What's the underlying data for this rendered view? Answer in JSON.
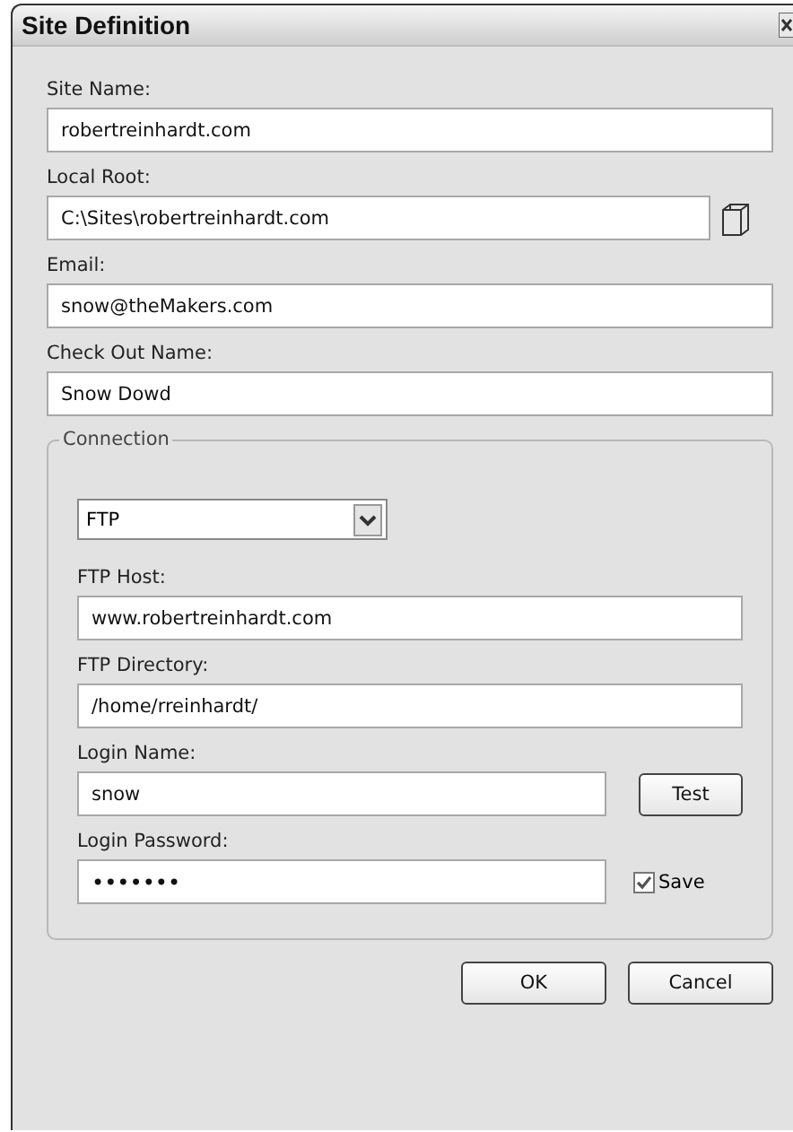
{
  "window": {
    "title": "Site Definition"
  },
  "fields": [
    {
      "label": "Site Name:",
      "value": "robertreinhardt.com",
      "kind": "text"
    },
    {
      "label": "Local Root:",
      "value": "C:\\Sites\\robertreinhardt.com",
      "kind": "browse"
    },
    {
      "label": "Email:",
      "value": "snow@theMakers.com",
      "kind": "text"
    },
    {
      "label": "Check Out Name:",
      "value": "Snow Dowd",
      "kind": "text"
    }
  ],
  "connection": {
    "legend": "Connection",
    "type": "FTP",
    "fields": [
      {
        "label": "FTP Host:",
        "value": "www.robertreinhardt.com",
        "kind": "text"
      },
      {
        "label": "FTP Directory:",
        "value": "/home/rreinhardt/",
        "kind": "text"
      },
      {
        "label": "Login Name:",
        "value": "snow",
        "kind": "test",
        "button": "Test"
      },
      {
        "label": "Login Password:",
        "value": "•••••••",
        "kind": "password",
        "checkbox": {
          "label": "Save",
          "checked": true
        }
      }
    ]
  },
  "buttons": [
    "OK",
    "Cancel"
  ]
}
